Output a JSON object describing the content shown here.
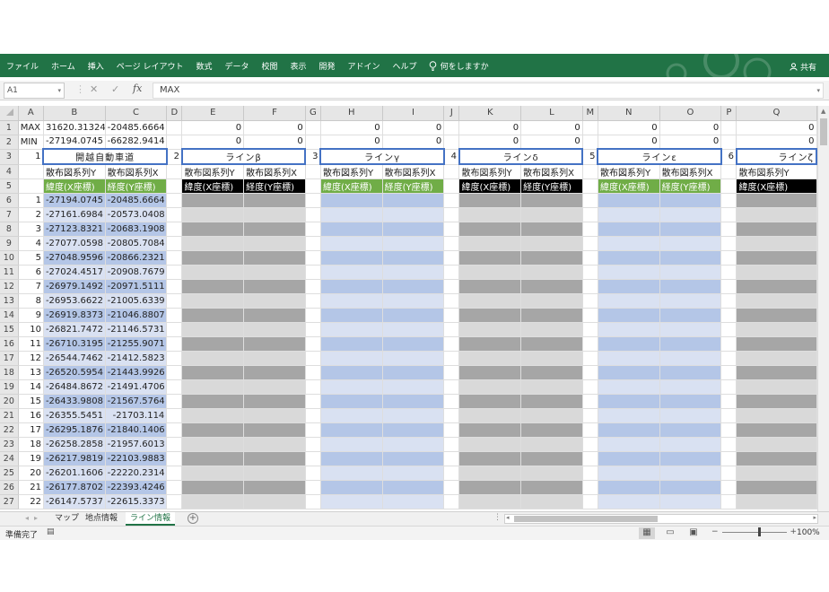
{
  "ribbon": {
    "tabs": [
      "ファイル",
      "ホーム",
      "挿入",
      "ページ レイアウト",
      "数式",
      "データ",
      "校閲",
      "表示",
      "開発",
      "アドイン",
      "ヘルプ"
    ],
    "tell_me": "何をしますか",
    "share": "共有"
  },
  "formula_bar": {
    "name_box": "A1",
    "formula": "MAX"
  },
  "sheet": {
    "columns": [
      "A",
      "B",
      "C",
      "D",
      "E",
      "F",
      "G",
      "H",
      "I",
      "J",
      "K",
      "L",
      "M",
      "N",
      "O",
      "P",
      "Q"
    ],
    "max_label": "MAX",
    "min_label": "MIN",
    "max_b": "31620.31324",
    "max_c": "-20485.6664",
    "min_b": "-27194.0745",
    "min_c": "-66282.9414",
    "zero": "0",
    "line_titles": [
      "開越自動車道",
      "ラインβ",
      "ラインγ",
      "ラインδ",
      "ラインε",
      "ラインζ"
    ],
    "line_indexes": [
      "1",
      "2",
      "3",
      "4",
      "5",
      "6"
    ],
    "scatter_y": "散布図系列Y",
    "scatter_x": "散布図系列X",
    "scatter_x_short": "散布",
    "lat_header": "緯度(X座標)",
    "lon_header": "経度(Y座標)",
    "lon_header_cut": "経度(Y",
    "row_numbers": [
      "1",
      "2",
      "3",
      "4",
      "5",
      "6",
      "7",
      "8",
      "9",
      "10",
      "11",
      "12",
      "13",
      "14",
      "15",
      "16",
      "17",
      "18",
      "19",
      "20",
      "21",
      "22",
      "23",
      "24",
      "25",
      "26",
      "27"
    ],
    "data_rows": [
      {
        "i": "1",
        "b": "-27194.0745",
        "c": "-20485.6664"
      },
      {
        "i": "2",
        "b": "-27161.6984",
        "c": "-20573.0408"
      },
      {
        "i": "3",
        "b": "-27123.8321",
        "c": "-20683.1908"
      },
      {
        "i": "4",
        "b": "-27077.0598",
        "c": "-20805.7084"
      },
      {
        "i": "5",
        "b": "-27048.9596",
        "c": "-20866.2321"
      },
      {
        "i": "6",
        "b": "-27024.4517",
        "c": "-20908.7679"
      },
      {
        "i": "7",
        "b": "-26979.1492",
        "c": "-20971.5111"
      },
      {
        "i": "8",
        "b": "-26953.6622",
        "c": "-21005.6339"
      },
      {
        "i": "9",
        "b": "-26919.8373",
        "c": "-21046.8807"
      },
      {
        "i": "10",
        "b": "-26821.7472",
        "c": "-21146.5731"
      },
      {
        "i": "11",
        "b": "-26710.3195",
        "c": "-21255.9071"
      },
      {
        "i": "12",
        "b": "-26544.7462",
        "c": "-21412.5823"
      },
      {
        "i": "13",
        "b": "-26520.5954",
        "c": "-21443.9926"
      },
      {
        "i": "14",
        "b": "-26484.8672",
        "c": "-21491.4706"
      },
      {
        "i": "15",
        "b": "-26433.9808",
        "c": "-21567.5764"
      },
      {
        "i": "16",
        "b": "-26355.5451",
        "c": "-21703.114"
      },
      {
        "i": "17",
        "b": "-26295.1876",
        "c": "-21840.1406"
      },
      {
        "i": "18",
        "b": "-26258.2858",
        "c": "-21957.6013"
      },
      {
        "i": "19",
        "b": "-26217.9819",
        "c": "-22103.9883"
      },
      {
        "i": "20",
        "b": "-26201.1606",
        "c": "-22220.2314"
      },
      {
        "i": "21",
        "b": "-26177.8702",
        "c": "-22393.4246"
      },
      {
        "i": "22",
        "b": "-26147.5737",
        "c": "-22615.3373"
      }
    ]
  },
  "sheet_tabs": [
    "マップ",
    "地点情報",
    "ライン情報"
  ],
  "active_sheet": "ライン情報",
  "status": {
    "ready": "準備完了",
    "zoom": "100%"
  },
  "colors": {
    "ribbon": "#217346",
    "header_green": "#70ad47",
    "header_black": "#000000",
    "band_blue": "#b4c6e7",
    "band_light_blue": "#d9e1f2",
    "band_gray": "#a6a6a6",
    "band_light_gray": "#d9d9d9",
    "title_border": "#4472c4"
  }
}
